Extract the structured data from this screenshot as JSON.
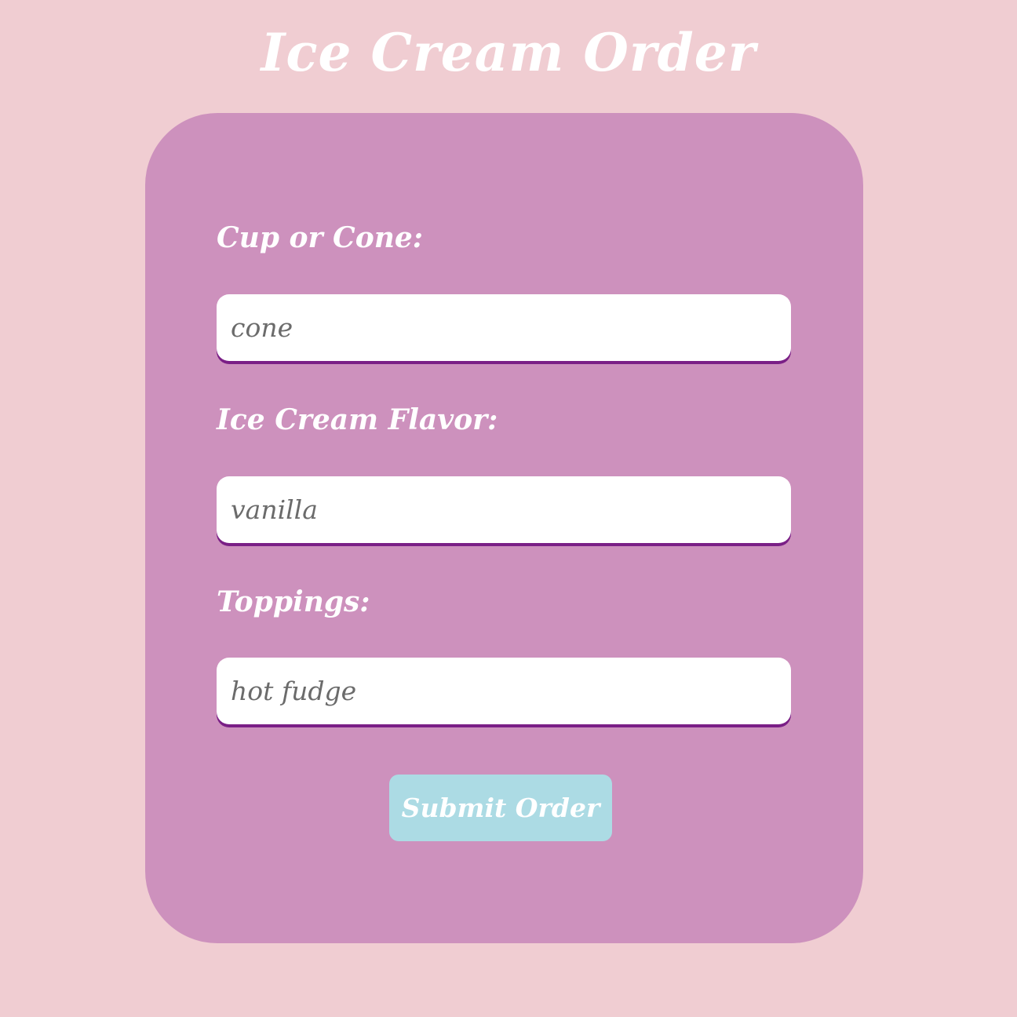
{
  "page": {
    "title": "Ice Cream Order"
  },
  "form": {
    "fields": [
      {
        "label": "Cup or Cone:",
        "value": "cone"
      },
      {
        "label": "Ice Cream Flavor:",
        "value": "vanilla"
      },
      {
        "label": "Toppings:",
        "value": "hot fudge"
      }
    ],
    "submit_label": "Submit Order"
  },
  "colors": {
    "page_background": "#f0cdd2",
    "card_background": "#cd91bd",
    "input_shadow": "#7a1f86",
    "button_background": "#acdbe4",
    "text_light": "#ffffff",
    "input_text": "#6b6b6b"
  }
}
